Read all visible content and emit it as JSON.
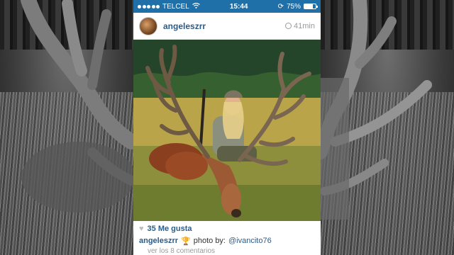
{
  "status_bar": {
    "carrier": "TELCEL",
    "time": "15:44",
    "battery": "75%",
    "battery_level": 0.75
  },
  "post": {
    "username": "angeleszrr",
    "time_ago": "41min",
    "likes": "35 Me gusta",
    "caption_user": "angeleszrr",
    "caption_text": "photo by:",
    "caption_mention": "@ivancito76",
    "comments_link": "ver los 8 comentarios"
  },
  "icons": {
    "wifi": "wifi-icon",
    "clock": "clock-icon",
    "heart": "heart-icon",
    "trophy": "trophy-icon"
  },
  "colors": {
    "status_bar": "#1f6fa8",
    "link": "#2b5c88"
  }
}
